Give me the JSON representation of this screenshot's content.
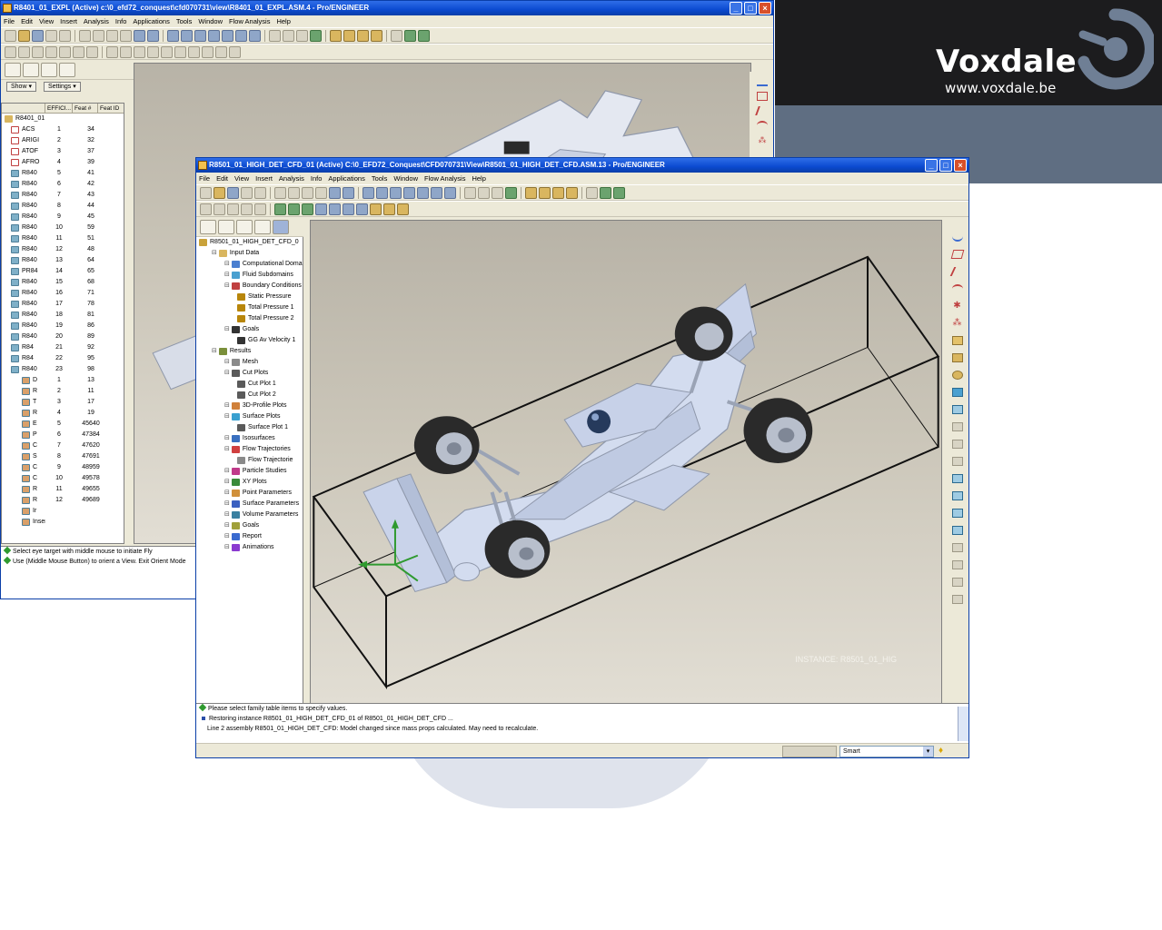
{
  "brand": {
    "name": "Voxdale",
    "url": "www.voxdale.be"
  },
  "back_window": {
    "title": "R8401_01_EXPL (Active) c:\\0_efd72_conquest\\cfd070731\\view\\R8401_01_EXPL.ASM.4 - Pro/ENGINEER",
    "menu": [
      "File",
      "Edit",
      "View",
      "Insert",
      "Analysis",
      "Info",
      "Applications",
      "Tools",
      "Window",
      "Flow Analysis",
      "Help"
    ],
    "show_btn": "Show ▾",
    "settings_btn": "Settings ▾",
    "columns": [
      "",
      "EFFICI...",
      "Feat #",
      "Feat ID"
    ],
    "root": "R8401_01",
    "rows": [
      {
        "name": "ACS",
        "eff": "1",
        "id": "34"
      },
      {
        "name": "ARIGI",
        "eff": "2",
        "id": "32"
      },
      {
        "name": "ATOF",
        "eff": "3",
        "id": "37"
      },
      {
        "name": "AFRO",
        "eff": "4",
        "id": "39"
      },
      {
        "name": "R840",
        "eff": "5",
        "id": "41"
      },
      {
        "name": "R840",
        "eff": "6",
        "id": "42"
      },
      {
        "name": "R840",
        "eff": "7",
        "id": "43"
      },
      {
        "name": "R840",
        "eff": "8",
        "id": "44"
      },
      {
        "name": "R840",
        "eff": "9",
        "id": "45"
      },
      {
        "name": "R840",
        "eff": "10",
        "id": "59"
      },
      {
        "name": "R840",
        "eff": "11",
        "id": "51"
      },
      {
        "name": "R840",
        "eff": "12",
        "id": "48"
      },
      {
        "name": "R840",
        "eff": "13",
        "id": "64"
      },
      {
        "name": "PR84",
        "eff": "14",
        "id": "65"
      },
      {
        "name": "R840",
        "eff": "15",
        "id": "68"
      },
      {
        "name": "R840",
        "eff": "16",
        "id": "71"
      },
      {
        "name": "R840",
        "eff": "17",
        "id": "78"
      },
      {
        "name": "R840",
        "eff": "18",
        "id": "81"
      },
      {
        "name": "R840",
        "eff": "19",
        "id": "86"
      },
      {
        "name": "R840",
        "eff": "20",
        "id": "89"
      },
      {
        "name": "R84",
        "eff": "21",
        "id": "92"
      },
      {
        "name": "R84",
        "eff": "22",
        "id": "95"
      },
      {
        "name": "R840",
        "eff": "23",
        "id": "98"
      },
      {
        "name": "D",
        "eff": "1",
        "id": "13"
      },
      {
        "name": "R",
        "eff": "2",
        "id": "11"
      },
      {
        "name": "T",
        "eff": "3",
        "id": "17"
      },
      {
        "name": "R",
        "eff": "4",
        "id": "19"
      },
      {
        "name": "E",
        "eff": "5",
        "id": "45640"
      },
      {
        "name": "P",
        "eff": "6",
        "id": "47384"
      },
      {
        "name": "C",
        "eff": "7",
        "id": "47620"
      },
      {
        "name": "S",
        "eff": "8",
        "id": "47691"
      },
      {
        "name": "C",
        "eff": "9",
        "id": "48959"
      },
      {
        "name": "C",
        "eff": "10",
        "id": "49578"
      },
      {
        "name": "R",
        "eff": "11",
        "id": "49655"
      },
      {
        "name": "R",
        "eff": "12",
        "id": "49689"
      },
      {
        "name": "Ir",
        "eff": "",
        "id": ""
      },
      {
        "name": "Insert",
        "eff": "",
        "id": ""
      }
    ],
    "status": [
      "Select eye target with middle mouse to initiate Fly",
      "Use (Middle Mouse Button) to orient a    View.   Exit Orient Mode"
    ]
  },
  "front_window": {
    "title": "R8501_01_HIGH_DET_CFD_01 (Active) C:\\0_EFD72_Conquest\\CFD070731\\View\\R8501_01_HIGH_DET_CFD.ASM.13 - Pro/ENGINEER",
    "menu": [
      "File",
      "Edit",
      "View",
      "Insert",
      "Analysis",
      "Info",
      "Applications",
      "Tools",
      "Window",
      "Flow Analysis",
      "Help"
    ],
    "tree": [
      {
        "label": "R8501_01_HIGH_DET_CFD_0",
        "indent": 0,
        "color": "#c9a23a"
      },
      {
        "label": "Input Data",
        "indent": 1,
        "color": "#d9b65f"
      },
      {
        "label": "Computational Doma",
        "indent": 2,
        "color": "#4a7fd0"
      },
      {
        "label": "Fluid Subdomains",
        "indent": 2,
        "color": "#4aa0d0"
      },
      {
        "label": "Boundary Conditions",
        "indent": 2,
        "color": "#c04040"
      },
      {
        "label": "Static Pressure",
        "indent": 3,
        "color": "#b8860b"
      },
      {
        "label": "Total Pressure 1",
        "indent": 3,
        "color": "#b8860b"
      },
      {
        "label": "Total Pressure 2",
        "indent": 3,
        "color": "#b8860b"
      },
      {
        "label": "Goals",
        "indent": 2,
        "color": "#333333"
      },
      {
        "label": "GG Av Velocity 1",
        "indent": 3,
        "color": "#333333"
      },
      {
        "label": "Results",
        "indent": 1,
        "color": "#7a8f3a"
      },
      {
        "label": "Mesh",
        "indent": 2,
        "color": "#8a8a8a"
      },
      {
        "label": "Cut Plots",
        "indent": 2,
        "color": "#5a5a5a"
      },
      {
        "label": "Cut Plot 1",
        "indent": 3,
        "color": "#5a5a5a"
      },
      {
        "label": "Cut Plot 2",
        "indent": 3,
        "color": "#5a5a5a"
      },
      {
        "label": "3D-Profile Plots",
        "indent": 2,
        "color": "#d0803a"
      },
      {
        "label": "Surface Plots",
        "indent": 2,
        "color": "#3aa0d0"
      },
      {
        "label": "Surface Plot 1",
        "indent": 3,
        "color": "#5a5a5a"
      },
      {
        "label": "Isosurfaces",
        "indent": 2,
        "color": "#3a70c0"
      },
      {
        "label": "Flow Trajectories",
        "indent": 2,
        "color": "#d04040"
      },
      {
        "label": "Flow Trajectorie",
        "indent": 3,
        "color": "#8a8a8a"
      },
      {
        "label": "Particle Studies",
        "indent": 2,
        "color": "#c03a8a"
      },
      {
        "label": "XY Plots",
        "indent": 2,
        "color": "#3a8a3a"
      },
      {
        "label": "Point Parameters",
        "indent": 2,
        "color": "#d0903a"
      },
      {
        "label": "Surface Parameters",
        "indent": 2,
        "color": "#3a60c0"
      },
      {
        "label": "Volume Parameters",
        "indent": 2,
        "color": "#3a80a0"
      },
      {
        "label": "Goals",
        "indent": 2,
        "color": "#a0a03a"
      },
      {
        "label": "Report",
        "indent": 2,
        "color": "#3a6ad0"
      },
      {
        "label": "Animations",
        "indent": 2,
        "color": "#8a3ad0"
      }
    ],
    "instance_label": "INSTANCE: R8501_01_HIG",
    "status": [
      "Please select family table items to specify values.",
      "Restoring instance R8501_01_HIGH_DET_CFD_01 of R8501_01_HIGH_DET_CFD ...",
      "Line 2 assembly R8501_01_HIGH_DET_CFD: Model changed since mass props calculated. May need to recalculate."
    ],
    "filter_value": "Smart"
  },
  "colors": {
    "brand_dark": "#1c1c1e",
    "brand_slate": "#5f6e82",
    "titlebar_blue": "#0b4ad0",
    "car_body": "#c9d3ea"
  }
}
